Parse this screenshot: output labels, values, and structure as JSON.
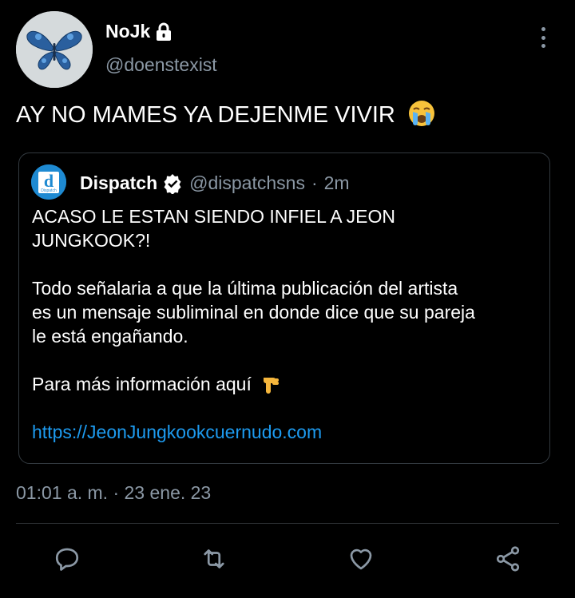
{
  "author": {
    "name": "NoJk",
    "handle": "@doenstexist"
  },
  "tweet": {
    "text": "AY NO MAMES YA DEJENME VIVIR"
  },
  "quote": {
    "name": "Dispatch",
    "handle": "@dispatchsns",
    "separator": "·",
    "time": "2m",
    "avatar_letter": "d",
    "avatar_word": "Dispatch",
    "line1": "ACASO LE ESTAN SIENDO INFIEL A JEON",
    "line2": "JUNGKOOK?!",
    "line3": "Todo señalaria a que la última publicación del artista",
    "line4": "es un mensaje subliminal en donde dice que su pareja",
    "line5": "le está engañando.",
    "line6": "Para más información aquí",
    "link": "https://JeonJungkookcuernudo.com"
  },
  "timestamp": "01:01 a. m. · 23 ene. 23",
  "actions": {
    "reply_icon": "reply-icon",
    "retweet_icon": "retweet-icon",
    "like_icon": "heart-icon",
    "share_icon": "share-icon"
  },
  "colors": {
    "background": "#000000",
    "text": "#e7e9ea",
    "muted": "#8b98a5",
    "link": "#1d9bf0",
    "verified": "#ffffff"
  }
}
